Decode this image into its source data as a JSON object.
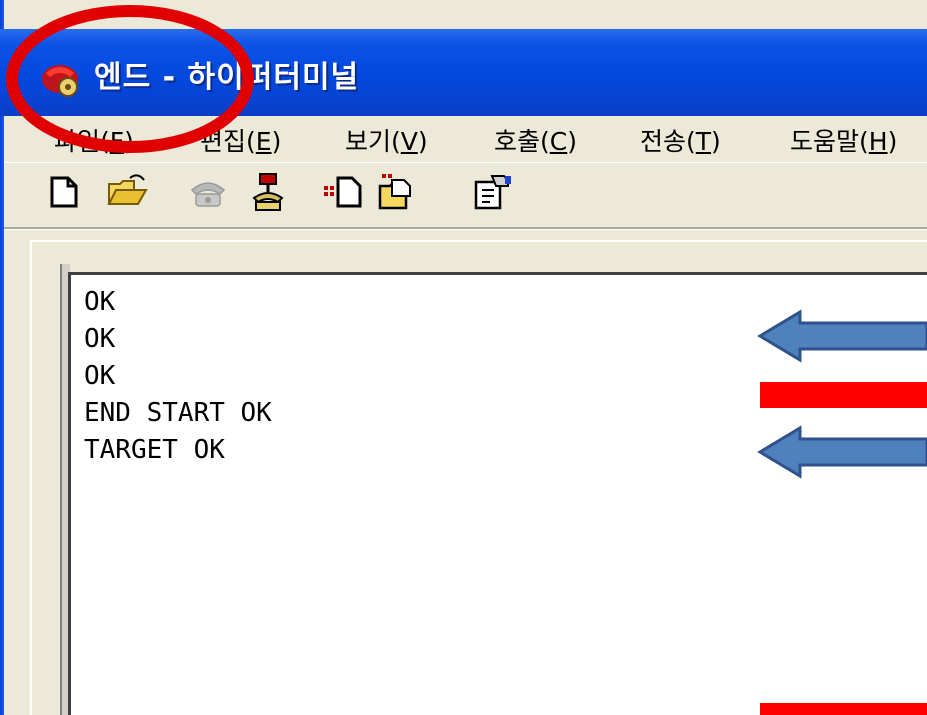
{
  "window": {
    "title": "엔드 - 하이퍼터미널"
  },
  "menu": [
    {
      "label": "파일(",
      "key": "F",
      "end": ")"
    },
    {
      "label": "편집(",
      "key": "E",
      "end": ")"
    },
    {
      "label": "보기(",
      "key": "V",
      "end": ")"
    },
    {
      "label": "호출(",
      "key": "C",
      "end": ")"
    },
    {
      "label": "전송(",
      "key": "T",
      "end": ")"
    },
    {
      "label": "도움말(",
      "key": "H",
      "end": ")"
    }
  ],
  "toolbar": {
    "icons": [
      "new-icon",
      "open-icon",
      "call-icon",
      "disconnect-icon",
      "send-file-icon",
      "receive-file-icon",
      "properties-icon"
    ]
  },
  "terminal": {
    "lines": [
      "OK",
      "OK",
      "OK",
      "END START OK",
      "TARGET OK"
    ]
  },
  "annotations": {
    "circle_color": "#e00000",
    "arrow_color": "#4f81bd",
    "bar_color": "#ff0000"
  }
}
